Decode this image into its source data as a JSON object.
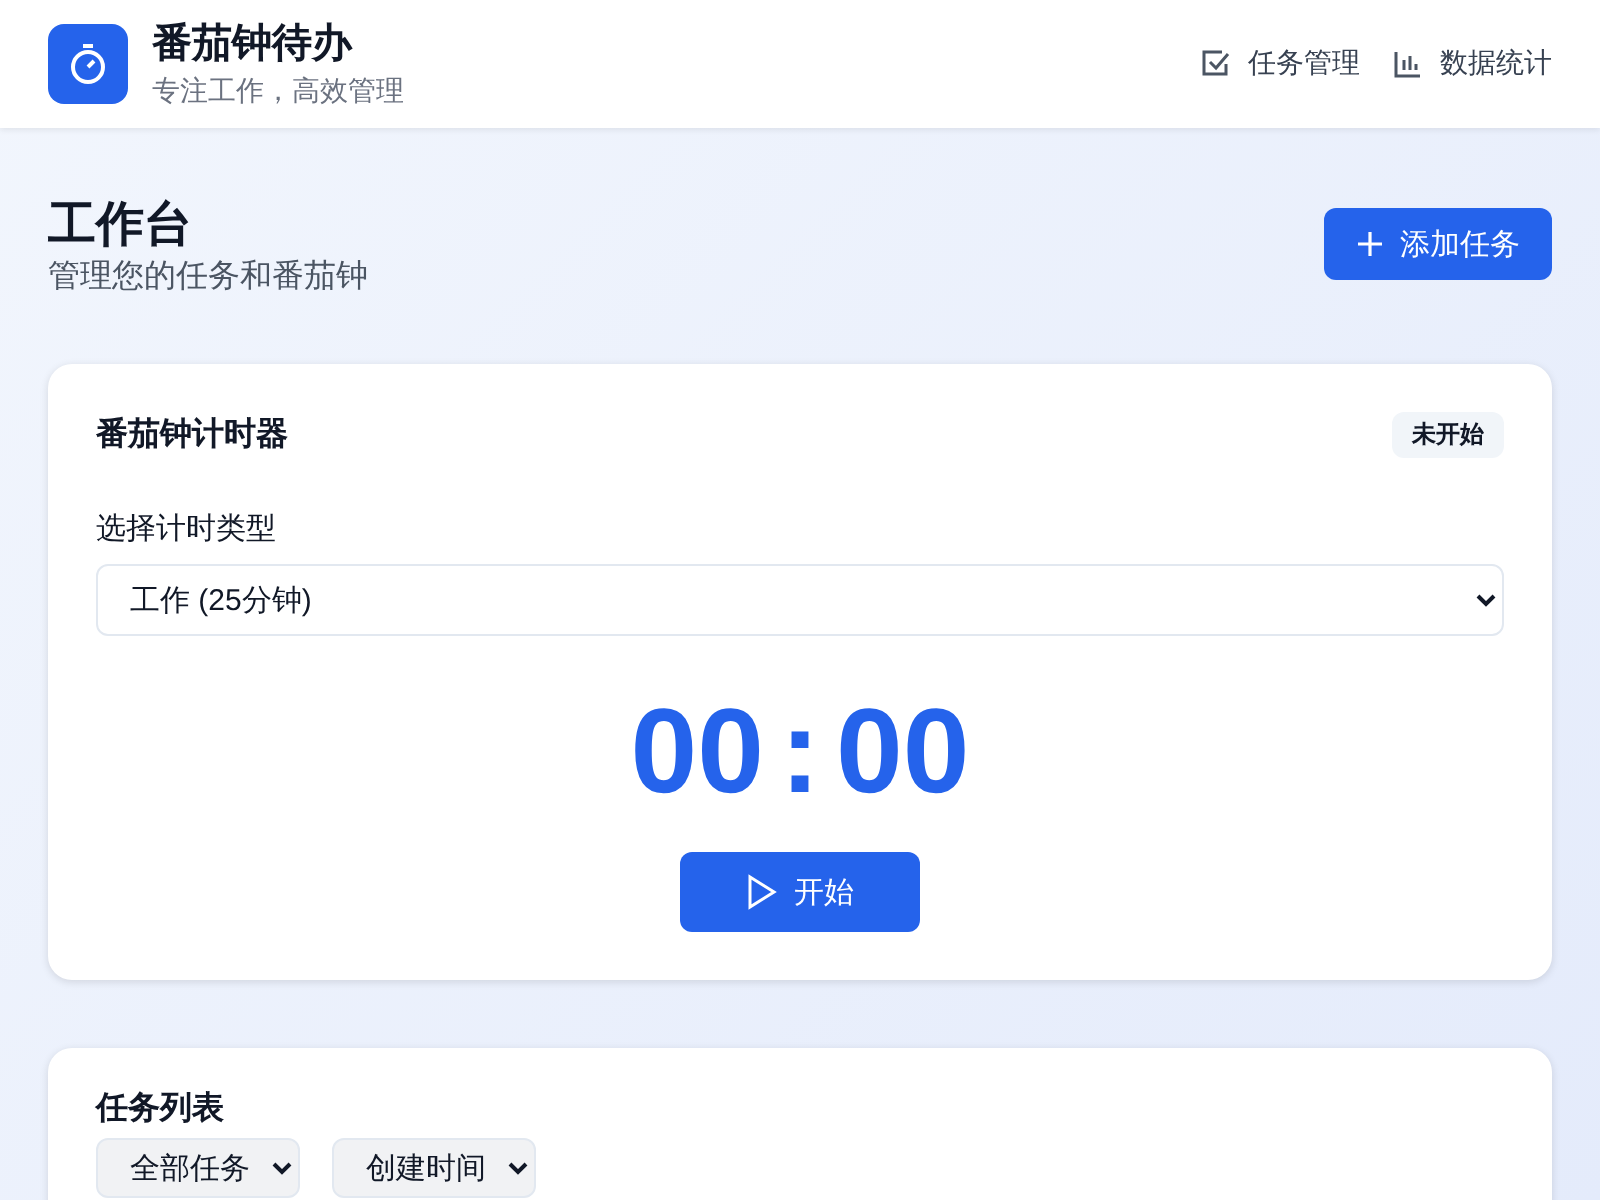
{
  "header": {
    "title": "番茄钟待办",
    "subtitle": "专注工作，高效管理",
    "nav": [
      {
        "kind": "tasks",
        "label": "任务管理"
      },
      {
        "kind": "stats",
        "label": "数据统计"
      }
    ]
  },
  "page": {
    "title": "工作台",
    "subtitle": "管理您的任务和番茄钟",
    "add_button": "添加任务"
  },
  "timer": {
    "title": "番茄钟计时器",
    "status": "未开始",
    "type_label": "选择计时类型",
    "type_value": "工作 (25分钟)",
    "minutes": "00",
    "separator": ":",
    "seconds": "00",
    "start_button": "开始"
  },
  "tasks": {
    "title": "任务列表",
    "filters": [
      {
        "value": "全部任务"
      },
      {
        "value": "创建时间"
      }
    ]
  }
}
